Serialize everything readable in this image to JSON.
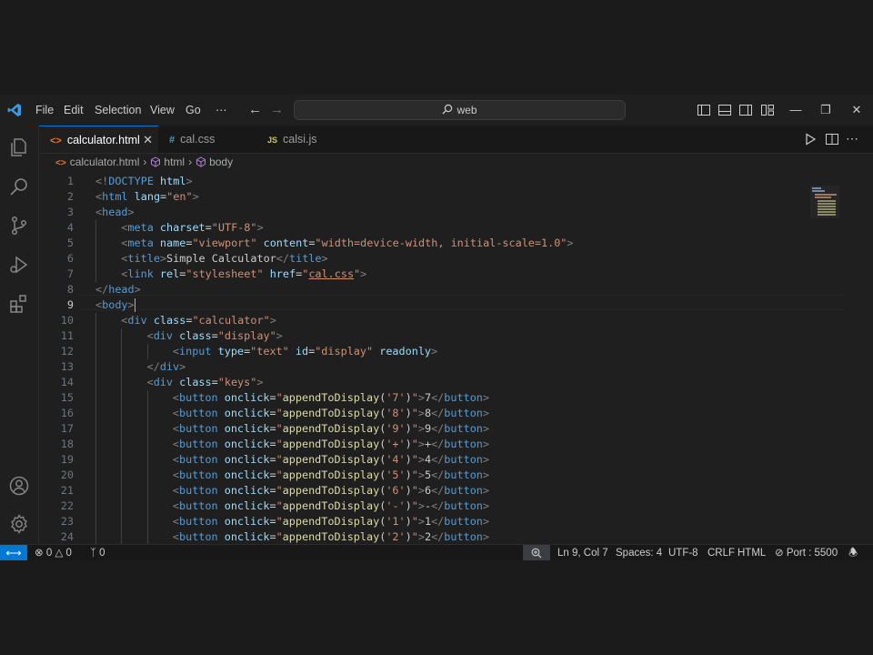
{
  "menu": [
    "File",
    "Edit",
    "Selection",
    "View",
    "Go",
    "⋯"
  ],
  "search": {
    "text": "web"
  },
  "tabs": [
    {
      "icon": "<>",
      "label": "calculator.html",
      "active": true,
      "close": "✕"
    },
    {
      "icon": "#",
      "label": "cal.css",
      "active": false
    },
    {
      "icon": "JS",
      "label": "calsi.js",
      "active": false
    }
  ],
  "breadcrumb": {
    "file": "calculator.html",
    "sep1": "›",
    "item1": "html",
    "sep2": "›",
    "item2": "body"
  },
  "colors": {
    "accent": "#0078d4",
    "html_icon": "#e37933",
    "css_icon": "#519aba",
    "js_icon": "#cbcb41"
  },
  "editor": {
    "current_line": 9,
    "lines": [
      {
        "n": "1",
        "indent": 0,
        "tokens": [
          [
            "t",
            "<!"
          ],
          [
            "n",
            "DOCTYPE"
          ],
          [
            "a",
            " html"
          ],
          [
            "t",
            ">"
          ]
        ]
      },
      {
        "n": "2",
        "indent": 0,
        "tokens": [
          [
            "t",
            "<"
          ],
          [
            "n",
            "html"
          ],
          [
            "a",
            " lang"
          ],
          [
            "tx",
            "="
          ],
          [
            "s",
            "\"en\""
          ],
          [
            "t",
            ">"
          ]
        ]
      },
      {
        "n": "3",
        "indent": 0,
        "tokens": [
          [
            "t",
            "<"
          ],
          [
            "n",
            "head"
          ],
          [
            "t",
            ">"
          ]
        ]
      },
      {
        "n": "4",
        "indent": 1,
        "tokens": [
          [
            "t",
            "<"
          ],
          [
            "n",
            "meta"
          ],
          [
            "a",
            " charset"
          ],
          [
            "tx",
            "="
          ],
          [
            "s",
            "\"UTF-8\""
          ],
          [
            "t",
            ">"
          ]
        ]
      },
      {
        "n": "5",
        "indent": 1,
        "tokens": [
          [
            "t",
            "<"
          ],
          [
            "n",
            "meta"
          ],
          [
            "a",
            " name"
          ],
          [
            "tx",
            "="
          ],
          [
            "s",
            "\"viewport\""
          ],
          [
            "a",
            " content"
          ],
          [
            "tx",
            "="
          ],
          [
            "s",
            "\"width=device-width, initial-scale=1.0\""
          ],
          [
            "t",
            ">"
          ]
        ]
      },
      {
        "n": "6",
        "indent": 1,
        "tokens": [
          [
            "t",
            "<"
          ],
          [
            "n",
            "title"
          ],
          [
            "t",
            ">"
          ],
          [
            "tx",
            "Simple Calculator"
          ],
          [
            "t",
            "</"
          ],
          [
            "n",
            "title"
          ],
          [
            "t",
            ">"
          ]
        ]
      },
      {
        "n": "7",
        "indent": 1,
        "tokens": [
          [
            "t",
            "<"
          ],
          [
            "n",
            "link"
          ],
          [
            "a",
            " rel"
          ],
          [
            "tx",
            "="
          ],
          [
            "s",
            "\"stylesheet\""
          ],
          [
            "a",
            " href"
          ],
          [
            "tx",
            "="
          ],
          [
            "s",
            "\""
          ],
          [
            "sq",
            "cal.css"
          ],
          [
            "s",
            "\""
          ],
          [
            "t",
            ">"
          ]
        ]
      },
      {
        "n": "8",
        "indent": 0,
        "tokens": [
          [
            "t",
            "</"
          ],
          [
            "n",
            "head"
          ],
          [
            "t",
            ">"
          ]
        ]
      },
      {
        "n": "9",
        "indent": 0,
        "tokens": [
          [
            "t",
            "<"
          ],
          [
            "n",
            "body"
          ],
          [
            "t",
            ">"
          ]
        ]
      },
      {
        "n": "10",
        "indent": 1,
        "tokens": [
          [
            "t",
            "<"
          ],
          [
            "n",
            "div"
          ],
          [
            "a",
            " class"
          ],
          [
            "tx",
            "="
          ],
          [
            "s",
            "\"calculator\""
          ],
          [
            "t",
            ">"
          ]
        ]
      },
      {
        "n": "11",
        "indent": 2,
        "tokens": [
          [
            "t",
            "<"
          ],
          [
            "n",
            "div"
          ],
          [
            "a",
            " class"
          ],
          [
            "tx",
            "="
          ],
          [
            "s",
            "\"display\""
          ],
          [
            "t",
            ">"
          ]
        ]
      },
      {
        "n": "12",
        "indent": 3,
        "tokens": [
          [
            "t",
            "<"
          ],
          [
            "n",
            "input"
          ],
          [
            "a",
            " type"
          ],
          [
            "tx",
            "="
          ],
          [
            "s",
            "\"text\""
          ],
          [
            "a",
            " id"
          ],
          [
            "tx",
            "="
          ],
          [
            "s",
            "\"display\""
          ],
          [
            "a",
            " readonly"
          ],
          [
            "t",
            ">"
          ]
        ]
      },
      {
        "n": "13",
        "indent": 2,
        "tokens": [
          [
            "t",
            "</"
          ],
          [
            "n",
            "div"
          ],
          [
            "t",
            ">"
          ]
        ]
      },
      {
        "n": "14",
        "indent": 2,
        "tokens": [
          [
            "t",
            "<"
          ],
          [
            "n",
            "div"
          ],
          [
            "a",
            " class"
          ],
          [
            "tx",
            "="
          ],
          [
            "s",
            "\"keys\""
          ],
          [
            "t",
            ">"
          ]
        ]
      },
      {
        "n": "15",
        "indent": 3,
        "tokens": [
          [
            "t",
            "<"
          ],
          [
            "n",
            "button"
          ],
          [
            "a",
            " onclick"
          ],
          [
            "tx",
            "="
          ],
          [
            "s",
            "\""
          ],
          [
            "f",
            "appendToDisplay"
          ],
          [
            "tx",
            "("
          ],
          [
            "s",
            "'7'"
          ],
          [
            "tx",
            ")"
          ],
          [
            "s",
            "\""
          ],
          [
            "t",
            ">"
          ],
          [
            "tx",
            "7"
          ],
          [
            "t",
            "</"
          ],
          [
            "n",
            "button"
          ],
          [
            "t",
            ">"
          ]
        ]
      },
      {
        "n": "16",
        "indent": 3,
        "tokens": [
          [
            "t",
            "<"
          ],
          [
            "n",
            "button"
          ],
          [
            "a",
            " onclick"
          ],
          [
            "tx",
            "="
          ],
          [
            "s",
            "\""
          ],
          [
            "f",
            "appendToDisplay"
          ],
          [
            "tx",
            "("
          ],
          [
            "s",
            "'8'"
          ],
          [
            "tx",
            ")"
          ],
          [
            "s",
            "\""
          ],
          [
            "t",
            ">"
          ],
          [
            "tx",
            "8"
          ],
          [
            "t",
            "</"
          ],
          [
            "n",
            "button"
          ],
          [
            "t",
            ">"
          ]
        ]
      },
      {
        "n": "17",
        "indent": 3,
        "tokens": [
          [
            "t",
            "<"
          ],
          [
            "n",
            "button"
          ],
          [
            "a",
            " onclick"
          ],
          [
            "tx",
            "="
          ],
          [
            "s",
            "\""
          ],
          [
            "f",
            "appendToDisplay"
          ],
          [
            "tx",
            "("
          ],
          [
            "s",
            "'9'"
          ],
          [
            "tx",
            ")"
          ],
          [
            "s",
            "\""
          ],
          [
            "t",
            ">"
          ],
          [
            "tx",
            "9"
          ],
          [
            "t",
            "</"
          ],
          [
            "n",
            "button"
          ],
          [
            "t",
            ">"
          ]
        ]
      },
      {
        "n": "18",
        "indent": 3,
        "tokens": [
          [
            "t",
            "<"
          ],
          [
            "n",
            "button"
          ],
          [
            "a",
            " onclick"
          ],
          [
            "tx",
            "="
          ],
          [
            "s",
            "\""
          ],
          [
            "f",
            "appendToDisplay"
          ],
          [
            "tx",
            "("
          ],
          [
            "s",
            "'+'"
          ],
          [
            "tx",
            ")"
          ],
          [
            "s",
            "\""
          ],
          [
            "t",
            ">"
          ],
          [
            "tx",
            "+"
          ],
          [
            "t",
            "</"
          ],
          [
            "n",
            "button"
          ],
          [
            "t",
            ">"
          ]
        ]
      },
      {
        "n": "19",
        "indent": 3,
        "tokens": [
          [
            "t",
            "<"
          ],
          [
            "n",
            "button"
          ],
          [
            "a",
            " onclick"
          ],
          [
            "tx",
            "="
          ],
          [
            "s",
            "\""
          ],
          [
            "f",
            "appendToDisplay"
          ],
          [
            "tx",
            "("
          ],
          [
            "s",
            "'4'"
          ],
          [
            "tx",
            ")"
          ],
          [
            "s",
            "\""
          ],
          [
            "t",
            ">"
          ],
          [
            "tx",
            "4"
          ],
          [
            "t",
            "</"
          ],
          [
            "n",
            "button"
          ],
          [
            "t",
            ">"
          ]
        ]
      },
      {
        "n": "20",
        "indent": 3,
        "tokens": [
          [
            "t",
            "<"
          ],
          [
            "n",
            "button"
          ],
          [
            "a",
            " onclick"
          ],
          [
            "tx",
            "="
          ],
          [
            "s",
            "\""
          ],
          [
            "f",
            "appendToDisplay"
          ],
          [
            "tx",
            "("
          ],
          [
            "s",
            "'5'"
          ],
          [
            "tx",
            ")"
          ],
          [
            "s",
            "\""
          ],
          [
            "t",
            ">"
          ],
          [
            "tx",
            "5"
          ],
          [
            "t",
            "</"
          ],
          [
            "n",
            "button"
          ],
          [
            "t",
            ">"
          ]
        ]
      },
      {
        "n": "21",
        "indent": 3,
        "tokens": [
          [
            "t",
            "<"
          ],
          [
            "n",
            "button"
          ],
          [
            "a",
            " onclick"
          ],
          [
            "tx",
            "="
          ],
          [
            "s",
            "\""
          ],
          [
            "f",
            "appendToDisplay"
          ],
          [
            "tx",
            "("
          ],
          [
            "s",
            "'6'"
          ],
          [
            "tx",
            ")"
          ],
          [
            "s",
            "\""
          ],
          [
            "t",
            ">"
          ],
          [
            "tx",
            "6"
          ],
          [
            "t",
            "</"
          ],
          [
            "n",
            "button"
          ],
          [
            "t",
            ">"
          ]
        ]
      },
      {
        "n": "22",
        "indent": 3,
        "tokens": [
          [
            "t",
            "<"
          ],
          [
            "n",
            "button"
          ],
          [
            "a",
            " onclick"
          ],
          [
            "tx",
            "="
          ],
          [
            "s",
            "\""
          ],
          [
            "f",
            "appendToDisplay"
          ],
          [
            "tx",
            "("
          ],
          [
            "s",
            "'-'"
          ],
          [
            "tx",
            ")"
          ],
          [
            "s",
            "\""
          ],
          [
            "t",
            ">"
          ],
          [
            "tx",
            "-"
          ],
          [
            "t",
            "</"
          ],
          [
            "n",
            "button"
          ],
          [
            "t",
            ">"
          ]
        ]
      },
      {
        "n": "23",
        "indent": 3,
        "tokens": [
          [
            "t",
            "<"
          ],
          [
            "n",
            "button"
          ],
          [
            "a",
            " onclick"
          ],
          [
            "tx",
            "="
          ],
          [
            "s",
            "\""
          ],
          [
            "f",
            "appendToDisplay"
          ],
          [
            "tx",
            "("
          ],
          [
            "s",
            "'1'"
          ],
          [
            "tx",
            ")"
          ],
          [
            "s",
            "\""
          ],
          [
            "t",
            ">"
          ],
          [
            "tx",
            "1"
          ],
          [
            "t",
            "</"
          ],
          [
            "n",
            "button"
          ],
          [
            "t",
            ">"
          ]
        ]
      },
      {
        "n": "24",
        "indent": 3,
        "tokens": [
          [
            "t",
            "<"
          ],
          [
            "n",
            "button"
          ],
          [
            "a",
            " onclick"
          ],
          [
            "tx",
            "="
          ],
          [
            "s",
            "\""
          ],
          [
            "f",
            "appendToDisplay"
          ],
          [
            "tx",
            "("
          ],
          [
            "s",
            "'2'"
          ],
          [
            "tx",
            ")"
          ],
          [
            "s",
            "\""
          ],
          [
            "t",
            ">"
          ],
          [
            "tx",
            "2"
          ],
          [
            "t",
            "</"
          ],
          [
            "n",
            "button"
          ],
          [
            "t",
            ">"
          ]
        ]
      }
    ]
  },
  "status": {
    "errors": "0",
    "warnings": "0",
    "ports": "0",
    "position": "Ln 9, Col 7",
    "spaces": "Spaces: 4",
    "encoding": "UTF-8",
    "eol": "CRLF",
    "language": "HTML",
    "port": "Port : 5500"
  }
}
